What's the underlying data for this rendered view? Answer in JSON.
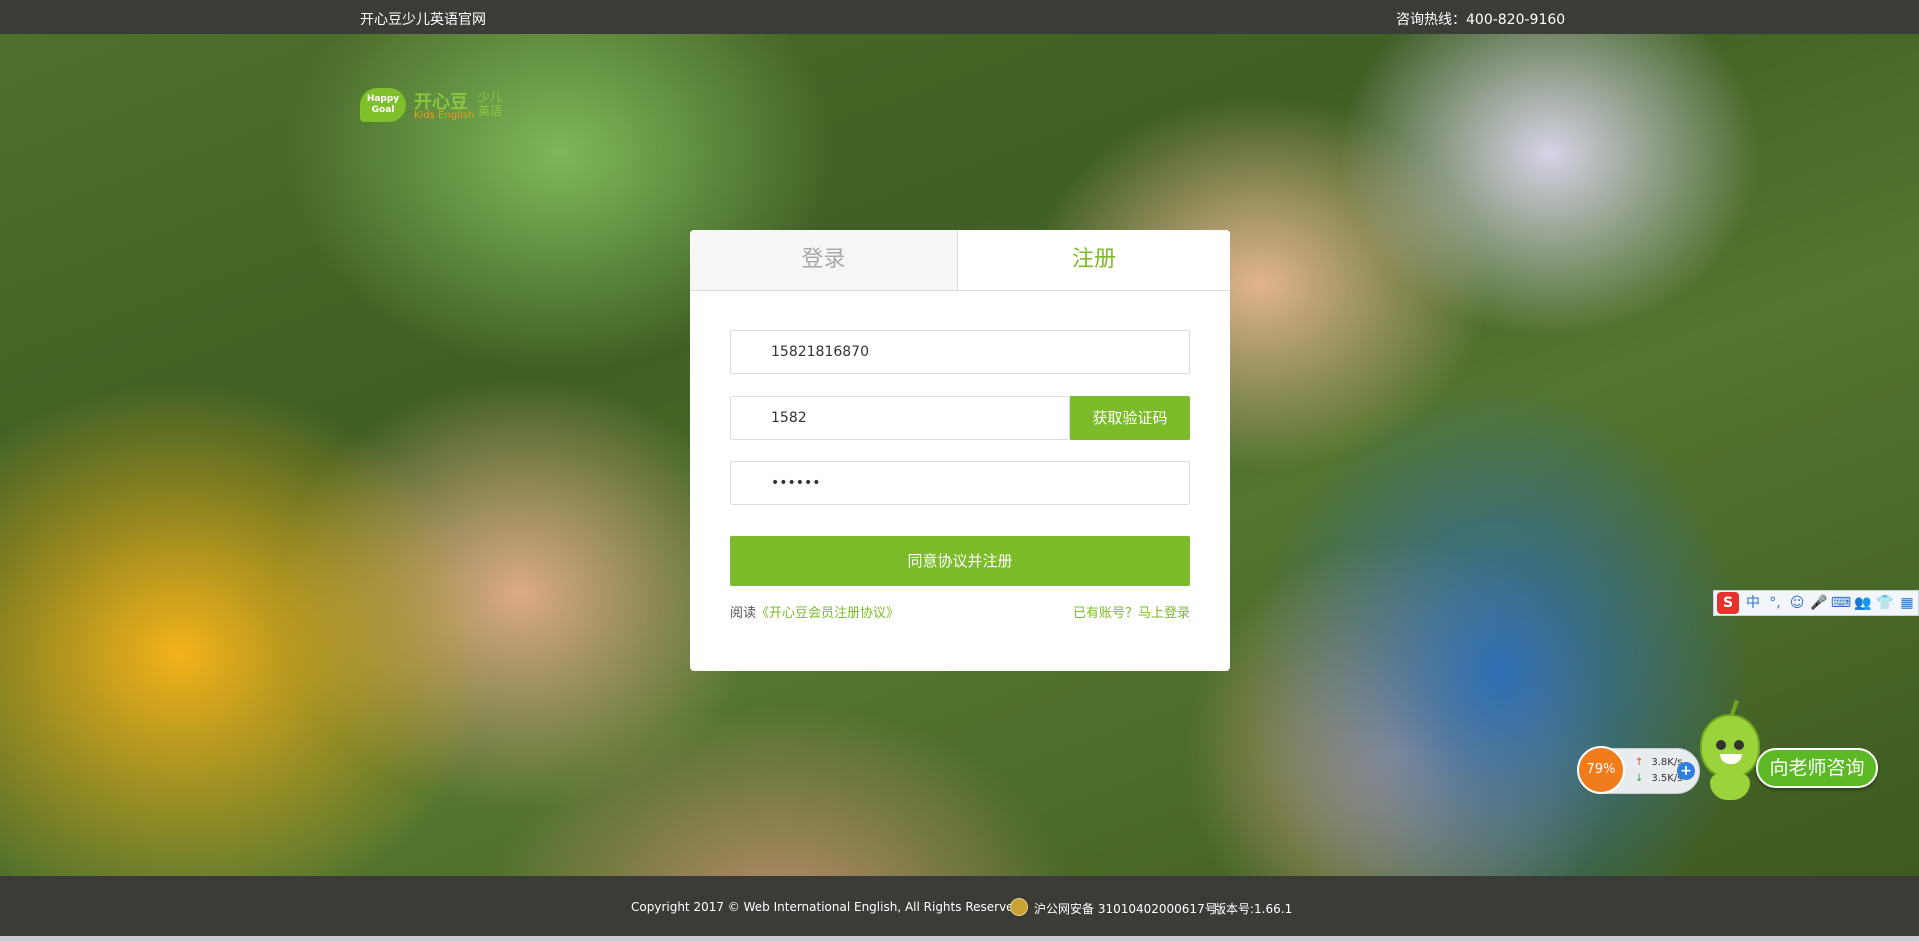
{
  "header": {
    "site_name": "开心豆少儿英语官网",
    "hotline": "咨询热线：400-820-9160"
  },
  "logo": {
    "badge_line1": "Happy",
    "badge_line2": "Goal",
    "name_cn": "开心豆",
    "name_en": "Kids English",
    "subtitle": "少儿英语"
  },
  "auth_card": {
    "tabs": [
      {
        "label": "登录",
        "active": false
      },
      {
        "label": "注册",
        "active": true
      }
    ],
    "phone_value": "15821816870",
    "code_value": "1582",
    "get_code_label": "获取验证码",
    "password_value": "••••••",
    "submit_label": "同意协议并注册",
    "agreement_prefix": "阅读",
    "agreement_link": "《开心豆会员注册协议》",
    "login_link": "已有账号？马上登录"
  },
  "ime_toolbar": {
    "logo": "S",
    "items": [
      "中",
      "°,",
      "☺",
      "🎤",
      "⌨",
      "👥",
      "👕",
      "▦"
    ]
  },
  "speed_widget": {
    "percent": "79%",
    "upload": "3.8K/s",
    "download": "3.5K/s",
    "add": "+"
  },
  "consult_button": {
    "label": "向老师咨询"
  },
  "footer": {
    "copyright": "Copyright 2017 © Web International English, All Rights Reserved",
    "icp": "沪公网安备 31010402000617号",
    "version": "版本号:1.66.1"
  },
  "colors": {
    "accent": "#7cbb29",
    "bar": "#3b3c37"
  }
}
